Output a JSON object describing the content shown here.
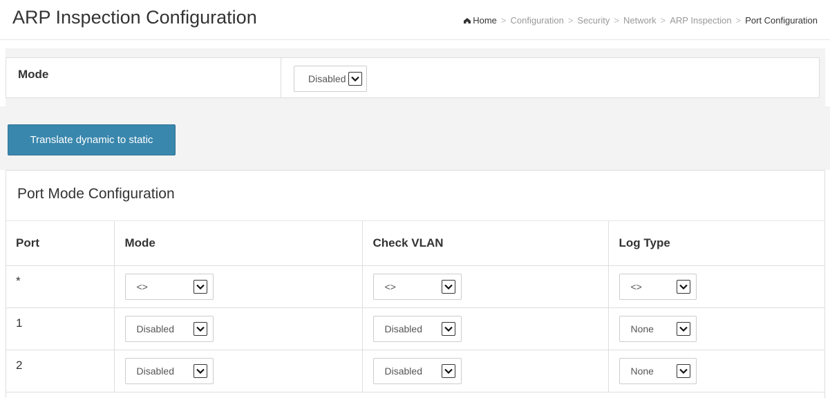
{
  "header": {
    "title": "ARP Inspection Configuration",
    "breadcrumb": {
      "home": "Home",
      "items": [
        "Configuration",
        "Security",
        "Network",
        "ARP Inspection"
      ],
      "current": "Port Configuration"
    }
  },
  "global": {
    "mode_label": "Mode",
    "mode_value": "Disabled"
  },
  "actions": {
    "translate_label": "Translate dynamic to static"
  },
  "port_mode": {
    "title": "Port Mode Configuration",
    "columns": [
      "Port",
      "Mode",
      "Check VLAN",
      "Log Type"
    ],
    "rows": [
      {
        "port": "*",
        "mode": "<>",
        "check_vlan": "<>",
        "log_type": "<>"
      },
      {
        "port": "1",
        "mode": "Disabled",
        "check_vlan": "Disabled",
        "log_type": "None"
      },
      {
        "port": "2",
        "mode": "Disabled",
        "check_vlan": "Disabled",
        "log_type": "None"
      }
    ]
  },
  "colors": {
    "button_bg": "#3a87ad",
    "page_bg": "#f3f3f3",
    "border": "#dddddd"
  },
  "icons": {
    "home": "home-icon",
    "dropdown": "chevron-down-icon"
  }
}
